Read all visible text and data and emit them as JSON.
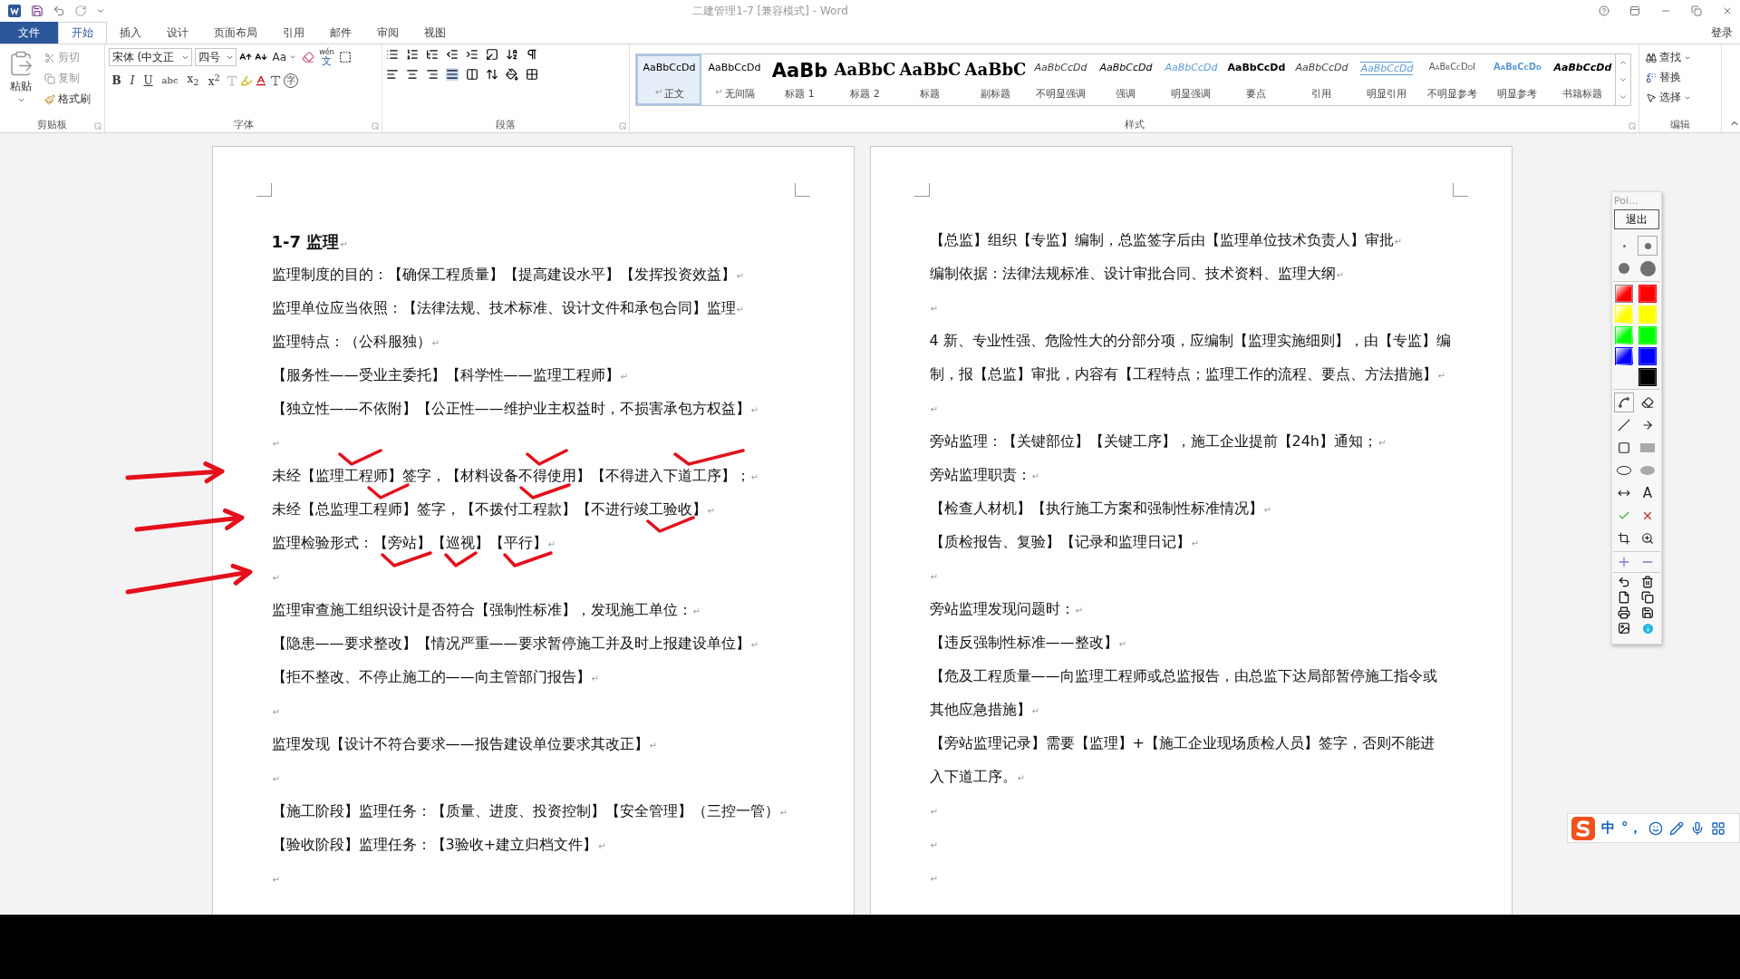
{
  "window": {
    "title": "二建管理1-7 [兼容模式] - Word",
    "account": "登录"
  },
  "menu_tabs": [
    {
      "label": "文件",
      "kind": "file",
      "selected": false
    },
    {
      "label": "开始",
      "kind": "tab",
      "selected": true
    },
    {
      "label": "插入",
      "kind": "tab",
      "selected": false
    },
    {
      "label": "设计",
      "kind": "tab",
      "selected": false
    },
    {
      "label": "页面布局",
      "kind": "tab",
      "selected": false
    },
    {
      "label": "引用",
      "kind": "tab",
      "selected": false
    },
    {
      "label": "邮件",
      "kind": "tab",
      "selected": false
    },
    {
      "label": "审阅",
      "kind": "tab",
      "selected": false
    },
    {
      "label": "视图",
      "kind": "tab",
      "selected": false
    }
  ],
  "clipboard": {
    "label": "剪贴板",
    "paste": "粘贴",
    "cut": "剪切",
    "copy": "复制",
    "format_painter": "格式刷"
  },
  "font": {
    "label": "字体",
    "font_name": "宋体 (中文正",
    "font_size": "四号",
    "case_button": "Aa",
    "phonetic_top": "wén",
    "phonetic_bottom": "文",
    "enclose_char": "字",
    "format_buttons": [
      "B",
      "I",
      "U",
      "abc",
      "x$_{2}$",
      "x$^{2}$"
    ]
  },
  "paragraph": {
    "label": "段落"
  },
  "styles": {
    "label": "样式",
    "items": [
      {
        "preview": "AaBbCcDd",
        "name": "正文",
        "mark": "↵",
        "kind": "normal",
        "selected": true
      },
      {
        "preview": "AaBbCcDd",
        "name": "无间隔",
        "mark": "↵",
        "kind": "normal",
        "selected": false
      },
      {
        "preview": "AaBb",
        "name": "标题 1",
        "kind": "heading1",
        "selected": false
      },
      {
        "preview": "AaBbC",
        "name": "标题 2",
        "kind": "heading2",
        "selected": false
      },
      {
        "preview": "AaBbC",
        "name": "标题",
        "kind": "title",
        "selected": false
      },
      {
        "preview": "AaBbC",
        "name": "副标题",
        "kind": "title",
        "selected": false
      },
      {
        "preview": "AaBbCcDd",
        "name": "不明显强调",
        "kind": "subtle",
        "selected": false
      },
      {
        "preview": "AaBbCcDd",
        "name": "强调",
        "kind": "emphasis",
        "selected": false
      },
      {
        "preview": "AaBbCcDd",
        "name": "明显强调",
        "kind": "intense",
        "selected": false
      },
      {
        "preview": "AaBbCcDd",
        "name": "要点",
        "kind": "strong",
        "selected": false
      },
      {
        "preview": "AaBbCcDd",
        "name": "引用",
        "kind": "subtle",
        "selected": false
      },
      {
        "preview": "AaBbCcDd",
        "name": "明显引用",
        "kind": "intense_quote",
        "selected": false
      },
      {
        "preview": "AaBbCcDdI",
        "name": "不明显参考",
        "kind": "subtle_ref",
        "selected": false
      },
      {
        "preview": "AaBbCcDd",
        "name": "明显参考",
        "kind": "intense_ref",
        "selected": false
      },
      {
        "preview": "AaBbCcDd",
        "name": "书籍标题",
        "kind": "book",
        "selected": false
      }
    ]
  },
  "editing": {
    "label": "编辑",
    "find": "查找",
    "replace": "替换",
    "select": "选择"
  },
  "pages": [
    {
      "paragraphs": [
        {
          "text": "1-7  监理",
          "kind": "heading",
          "mark": "↵"
        },
        {
          "text": "监理制度的目的：【确保工程质量】【提高建设水平】【发挥投资效益】",
          "mark": "↵"
        },
        {
          "text": "监理单位应当依照：【法律法规、技术标准、设计文件和承包合同】监理",
          "mark": "↵"
        },
        {
          "text": "监理特点：（公科服独）",
          "mark": "↵"
        },
        {
          "text": "【服务性——受业主委托】【科学性——监理工程师】",
          "mark": "↵"
        },
        {
          "text": "【独立性——不依附】【公正性——维护业主权益时，不损害承包方权益】",
          "mark": "↵"
        },
        {
          "mark": "↵"
        },
        {
          "text": "未经【监理工程师】签字，【材料设备不得使用】【不得进入下道工序】；",
          "mark": "↵"
        },
        {
          "text": "未经【总监理工程师】签字，【不拨付工程款】【不进行竣工验收】",
          "mark": "↵"
        },
        {
          "text": "监理检验形式：【旁站】【巡视】【平行】",
          "mark": "↵"
        },
        {
          "mark": "↵"
        },
        {
          "text": "监理审查施工组织设计是否符合【强制性标准】，发现施工单位：",
          "mark": "↵"
        },
        {
          "text": "【隐患——要求整改】【情况严重——要求暂停施工并及时上报建设单位】",
          "mark": "↵"
        },
        {
          "text": "【拒不整改、不停止施工的——向主管部门报告】",
          "mark": "↵"
        },
        {
          "mark": "↵"
        },
        {
          "text": "监理发现【设计不符合要求——报告建设单位要求其改正】",
          "mark": "↵"
        },
        {
          "mark": "↵"
        },
        {
          "text": "【施工阶段】监理任务：【质量、进度、投资控制】【安全管理】（三控一管）",
          "mark": "↵"
        },
        {
          "text": "【验收阶段】监理任务：【3验收+建立归档文件】",
          "mark": "↵"
        },
        {
          "mark": "↵"
        }
      ]
    },
    {
      "paragraphs": [
        {
          "text": "【总监】组织【专监】编制，总监签字后由【监理单位技术负责人】审批",
          "mark": "↵"
        },
        {
          "text": "编制依据：法律法规标准、设计审批合同、技术资料、监理大纲",
          "mark": "↵"
        },
        {
          "mark": "↵"
        },
        {
          "lines": [
            "4 新、专业性强、危险性大的分部分项，应编制【监理实施细则】，由【专监】编",
            "制，报【总监】审批，内容有【工程特点；监理工作的流程、要点、方法措施】"
          ],
          "mark": "↵"
        },
        {
          "mark": "↵"
        },
        {
          "text": "旁站监理：【关键部位】【关键工序】，施工企业提前【24h】通知；",
          "mark": "↵"
        },
        {
          "text": "旁站监理职责：",
          "mark": "↵"
        },
        {
          "text": "【检查人材机】【执行施工方案和强制性标准情况】",
          "mark": "↵"
        },
        {
          "text": "【质检报告、复验】【记录和监理日记】",
          "mark": "↵"
        },
        {
          "mark": "↵"
        },
        {
          "text": "旁站监理发现问题时：",
          "mark": "↵"
        },
        {
          "text": "【违反强制性标准——整改】",
          "mark": "↵"
        },
        {
          "lines": [
            "【危及工程质量——向监理工程师或总监报告，由总监下达局部暂停施工指令或",
            "其他应急措施】"
          ],
          "mark": "↵"
        },
        {
          "lines": [
            "【旁站监理记录】需要【监理】+【施工企业现场质检人员】签字，否则不能进",
            "入下道工序。"
          ],
          "mark": "↵"
        },
        {
          "mark": "↵"
        },
        {
          "mark": "↵"
        },
        {
          "mark": "↵"
        }
      ]
    }
  ],
  "pen_panel": {
    "title": "Poi...",
    "exit": "退出",
    "sizes": [
      {
        "selected": false
      },
      {
        "selected": true
      },
      {
        "selected": false
      },
      {
        "selected": false
      }
    ],
    "colors": [
      {
        "color": "#ff0000",
        "kind": "gradient",
        "selected": true
      },
      {
        "color": "#ff0000",
        "kind": "solid",
        "selected": false
      },
      {
        "color": "#ffff00",
        "kind": "gradient",
        "selected": false
      },
      {
        "color": "#ffff00",
        "kind": "solid",
        "selected": false
      },
      {
        "color": "#00ff00",
        "kind": "gradient",
        "selected": false
      },
      {
        "color": "#00ff00",
        "kind": "solid",
        "selected": false
      },
      {
        "color": "#0000ff",
        "kind": "gradient",
        "selected": false
      },
      {
        "color": "#0000ff",
        "kind": "solid",
        "selected": false
      },
      {
        "color": "#000000",
        "kind": "solid",
        "selected": false
      }
    ],
    "tools": [
      {
        "selected": true
      },
      {
        "selected": false
      },
      {
        "selected": false
      },
      {
        "selected": false
      },
      {
        "selected": false
      },
      {
        "selected": false
      },
      {
        "selected": false
      },
      {
        "selected": false
      },
      {
        "selected": false
      },
      {
        "selected": false,
        "label": "A"
      },
      {
        "selected": false
      },
      {
        "selected": false
      },
      {
        "selected": false
      },
      {
        "selected": false
      }
    ]
  },
  "ime_bar": {
    "mode": "中",
    "punct": "°，"
  }
}
